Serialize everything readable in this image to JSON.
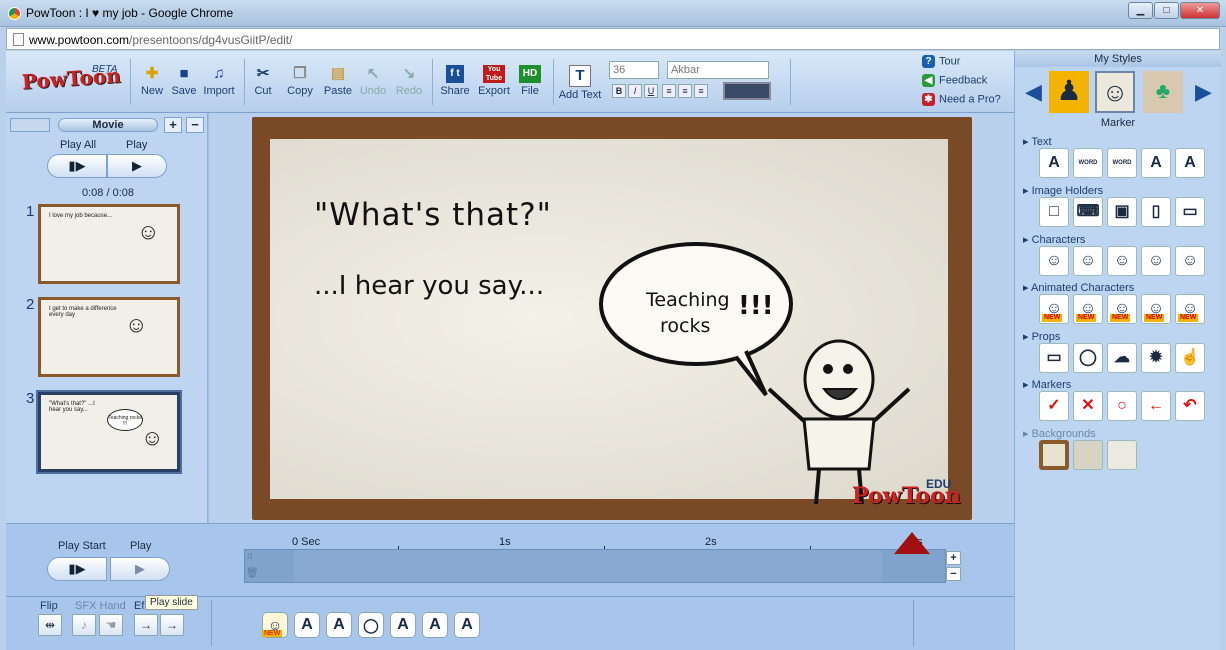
{
  "window": {
    "title": "PowToon : I ♥ my job - Google Chrome",
    "minimize": "▁",
    "maximize": "□",
    "close": "✕"
  },
  "address": {
    "host": "www.powtoon.com",
    "path": "/presentoons/dg4vusGiitP/edit/"
  },
  "brand": {
    "logo": "PowToon",
    "beta": "BETA"
  },
  "toolbar": {
    "new": "New",
    "save": "Save",
    "import": "Import",
    "cut": "Cut",
    "copy": "Copy",
    "paste": "Paste",
    "undo": "Undo",
    "redo": "Redo",
    "share": "Share",
    "export": "Export",
    "file": "File",
    "add_text": "Add Text",
    "font_size": "36",
    "font_name": "Akbar",
    "bold": "B",
    "italic": "I",
    "underline": "U",
    "export_icon_text": "You Tube",
    "file_icon_text": "HD"
  },
  "help": {
    "tour": "Tour",
    "feedback": "Feedback",
    "pro": "Need a Pro?"
  },
  "left": {
    "movie_label": "Movie",
    "play_all": "Play All",
    "play": "Play",
    "time": "0:08 / 0:08",
    "slides": [
      {
        "num": "1",
        "text": "I love my job because..."
      },
      {
        "num": "2",
        "text": "I get to make a difference every day"
      },
      {
        "num": "3",
        "text": "\"What's that?\" ...I hear you say...",
        "bubble": "Teaching rocks !!!"
      }
    ]
  },
  "stage": {
    "line1": "\"What's that?\"",
    "line2": "...I hear you say...",
    "bubble_line1": "Teaching",
    "bubble_line2": "rocks",
    "bubble_excl": "!!!",
    "watermark": "PowToon",
    "watermark_sup": "EDU"
  },
  "right": {
    "my_styles": "My Styles",
    "style_name": "Marker",
    "categories": {
      "text": "Text",
      "image_holders": "Image Holders",
      "characters": "Characters",
      "animated": "Animated Characters",
      "props": "Props",
      "markers": "Markers",
      "backgrounds": "Backgrounds"
    },
    "text_cells": [
      "A",
      "WORD",
      "WORD",
      "A",
      "A"
    ]
  },
  "timeline": {
    "play_start": "Play Start",
    "play": "Play",
    "ticks": [
      "0 Sec",
      "1s",
      "2s",
      "3s"
    ],
    "tooltip": "Play slide",
    "flip": "Flip",
    "sfx_hand": "SFX Hand",
    "effect_abbrev": "Ef",
    "text_cells": [
      "A",
      "A",
      "A",
      "A",
      "A"
    ]
  },
  "colors": {
    "accent": "#1d3d70",
    "brand": "#c22222",
    "playhead": "#a01010"
  }
}
